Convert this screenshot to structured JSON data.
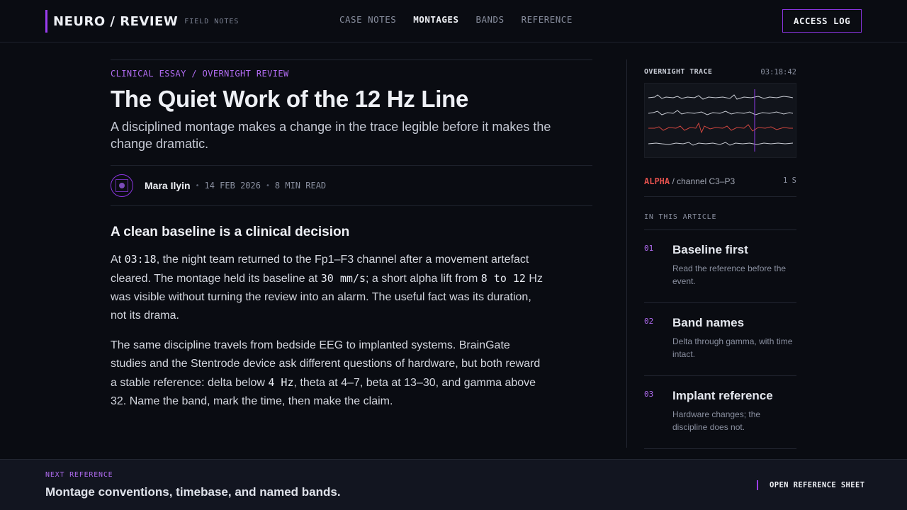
{
  "header": {
    "brand": "NEURO / REVIEW",
    "brand_sub": "FIELD NOTES",
    "nav": [
      {
        "label": "CASE NOTES",
        "active": false
      },
      {
        "label": "MONTAGES",
        "active": true
      },
      {
        "label": "BANDS",
        "active": false
      },
      {
        "label": "REFERENCE",
        "active": false
      }
    ],
    "access_button": "ACCESS LOG"
  },
  "article": {
    "kicker": "CLINICAL ESSAY / OVERNIGHT REVIEW",
    "title": "The Quiet Work of the 12 Hz Line",
    "dek": "A disciplined montage makes a change in the trace legible before it makes the change dramatic.",
    "author": "Mara Ilyin",
    "date": "14 FEB 2026",
    "read_time": "8 MIN READ",
    "section_heading": "A clean baseline is a clinical decision",
    "p1": {
      "t1": "At ",
      "c1": "03:18",
      "t2": ", the night team returned to the Fp1–F3 channel after a movement artefact cleared. The montage held its baseline at ",
      "c2": "30 mm/s",
      "t3": "; a short alpha lift from ",
      "c3": "8 to 12",
      "t4": " Hz was visible without turning the review into an alarm. The useful fact was its duration, not its drama."
    },
    "p2": {
      "t1": "The same discipline travels from bedside EEG to implanted systems. BrainGate studies and the Stentrode device ask different questions of hardware, but both reward a stable reference: delta below ",
      "c1": "4 Hz",
      "t2": ", theta at 4–7, beta at 13–30, and gamma above 32. Name the band, mark the time, then make the claim."
    }
  },
  "sidebar": {
    "trace_title": "OVERNIGHT TRACE",
    "trace_time": "03:18:42",
    "band_name": "ALPHA",
    "band_channel": " / channel C3–P3",
    "band_scale": "1 S",
    "toc_title": "IN THIS ARTICLE",
    "toc": [
      {
        "num": "01",
        "heading": "Baseline first",
        "desc": "Read the reference before the event."
      },
      {
        "num": "02",
        "heading": "Band names",
        "desc": "Delta through gamma, with time intact."
      },
      {
        "num": "03",
        "heading": "Implant reference",
        "desc": "Hardware changes; the discipline does not."
      }
    ]
  },
  "footer": {
    "next_label": "NEXT REFERENCE",
    "next_title": "Montage conventions, timebase, and named bands.",
    "open_link": "OPEN REFERENCE SHEET"
  },
  "colors": {
    "accent": "#9b3df0",
    "accent_text": "#b16cf2",
    "alert": "#e0504c",
    "background": "#0a0c12"
  }
}
